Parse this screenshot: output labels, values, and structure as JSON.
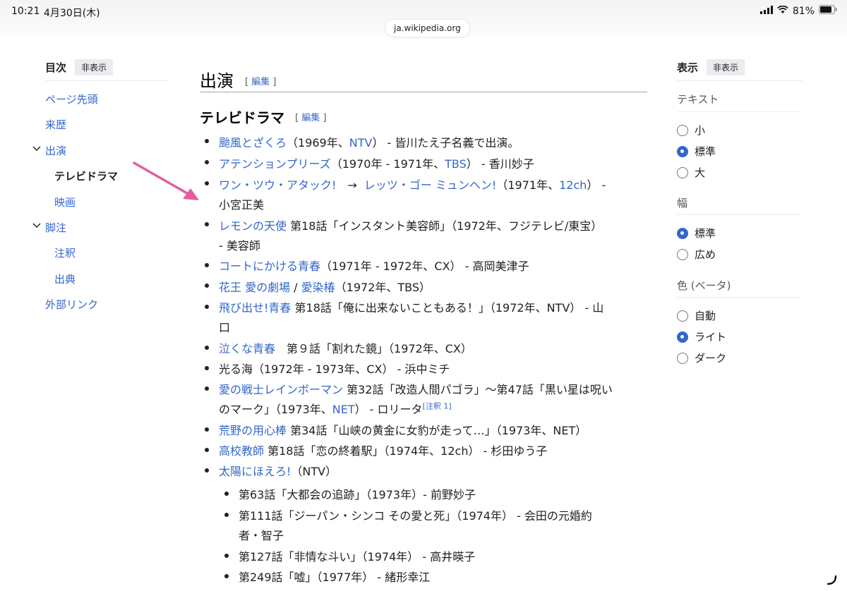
{
  "status": {
    "time": "10:21",
    "date": "4月30日(木)",
    "battery": "81%"
  },
  "browser": {
    "url": "ja.wikipedia.org"
  },
  "toc": {
    "title": "目次",
    "hide_label": "非表示",
    "items": [
      {
        "label": "ページ先頭"
      },
      {
        "label": "来歴"
      },
      {
        "label": "出演"
      },
      {
        "label": "テレビドラマ"
      },
      {
        "label": "映画"
      },
      {
        "label": "脚注"
      },
      {
        "label": "注釈"
      },
      {
        "label": "出典"
      },
      {
        "label": "外部リンク"
      }
    ]
  },
  "section": {
    "title": "出演",
    "edit_open": "[",
    "edit_label": "編集",
    "edit_close": "]",
    "sub_title": "テレビドラマ"
  },
  "entries": {
    "e1": {
      "link": "颱風とざくろ",
      "a": "（1969年、",
      "link2": "NTV",
      "b": "） - 皆川たえ子名義で出演。"
    },
    "e2": {
      "link": "アテンションプリーズ",
      "a": "（1970年 - 1971年、",
      "link2": "TBS",
      "b": "） - 香川妙子"
    },
    "e3": {
      "link": "ワン・ツウ・アタック!",
      "arrow": "→",
      "link2": "レッツ・ゴー ミュンヘン!",
      "a": "（1971年、",
      "link3": "12ch",
      "b": "） -",
      "cont": "小宮正美"
    },
    "e4": {
      "link": "レモンの天使",
      "a": " 第18話「インスタント美容師」（1972年、フジテレビ/東宝）",
      "cont": "- 美容師"
    },
    "e5": {
      "link": "コートにかける青春",
      "a": "（1971年 - 1972年、CX） - 高岡美津子"
    },
    "e6": {
      "link": "花王 愛の劇場",
      "sep": " / ",
      "link2": "愛染椿",
      "a": "（1972年、TBS）"
    },
    "e7": {
      "link": "飛び出せ!青春",
      "a": " 第18話「俺に出来ないこともある！」（1972年、NTV） - 山",
      "cont": "口"
    },
    "e8": {
      "link": "泣くな青春",
      "a": "　第９話「割れた鏡」（1972年、CX）"
    },
    "e9": {
      "a": "光る海（1972年 - 1973年、CX） - 浜中ミチ"
    },
    "e10": {
      "link": "愛の戦士レインボーマン",
      "a": " 第32話「改造人間パゴラ」〜第47話「黒い星は呪い",
      "cont1": "のマーク」（1973年、",
      "link2": "NET",
      "cont2": "） - ロリータ",
      "note": "[注釈 1]"
    },
    "e11": {
      "link": "荒野の用心棒",
      "a": " 第34話「山峡の黄金に女豹が走って…」（1973年、NET）"
    },
    "e12": {
      "link": "高校教師",
      "a": " 第18話「恋の終着駅」（1974年、12ch） - 杉田ゆう子"
    },
    "e13": {
      "link": "太陽にほえろ!",
      "a": "（NTV）"
    },
    "s1": {
      "a": "第63話「大都会の追跡」（1973年）- 前野妙子"
    },
    "s2": {
      "a": "第111話「ジーパン・シンコ その愛と死」（1974年） - 会田の元婚約",
      "cont": "者・智子"
    },
    "s3": {
      "a": "第127話「非情な斗い」（1974年） - 高井暎子"
    },
    "s4": {
      "a": "第249話「嘘」（1977年） - 緒形幸江"
    }
  },
  "appearance": {
    "title": "表示",
    "hide_label": "非表示",
    "text_section": "テキスト",
    "text_options": [
      "小",
      "標準",
      "大"
    ],
    "text_selected": "標準",
    "width_section": "幅",
    "width_options": [
      "標準",
      "広め"
    ],
    "width_selected": "標準",
    "color_section": "色 (ベータ)",
    "color_options": [
      "自動",
      "ライト",
      "ダーク"
    ],
    "color_selected": "ライト"
  },
  "colors": {
    "link": "#3366cc",
    "annotation_arrow": "#e0609f"
  }
}
